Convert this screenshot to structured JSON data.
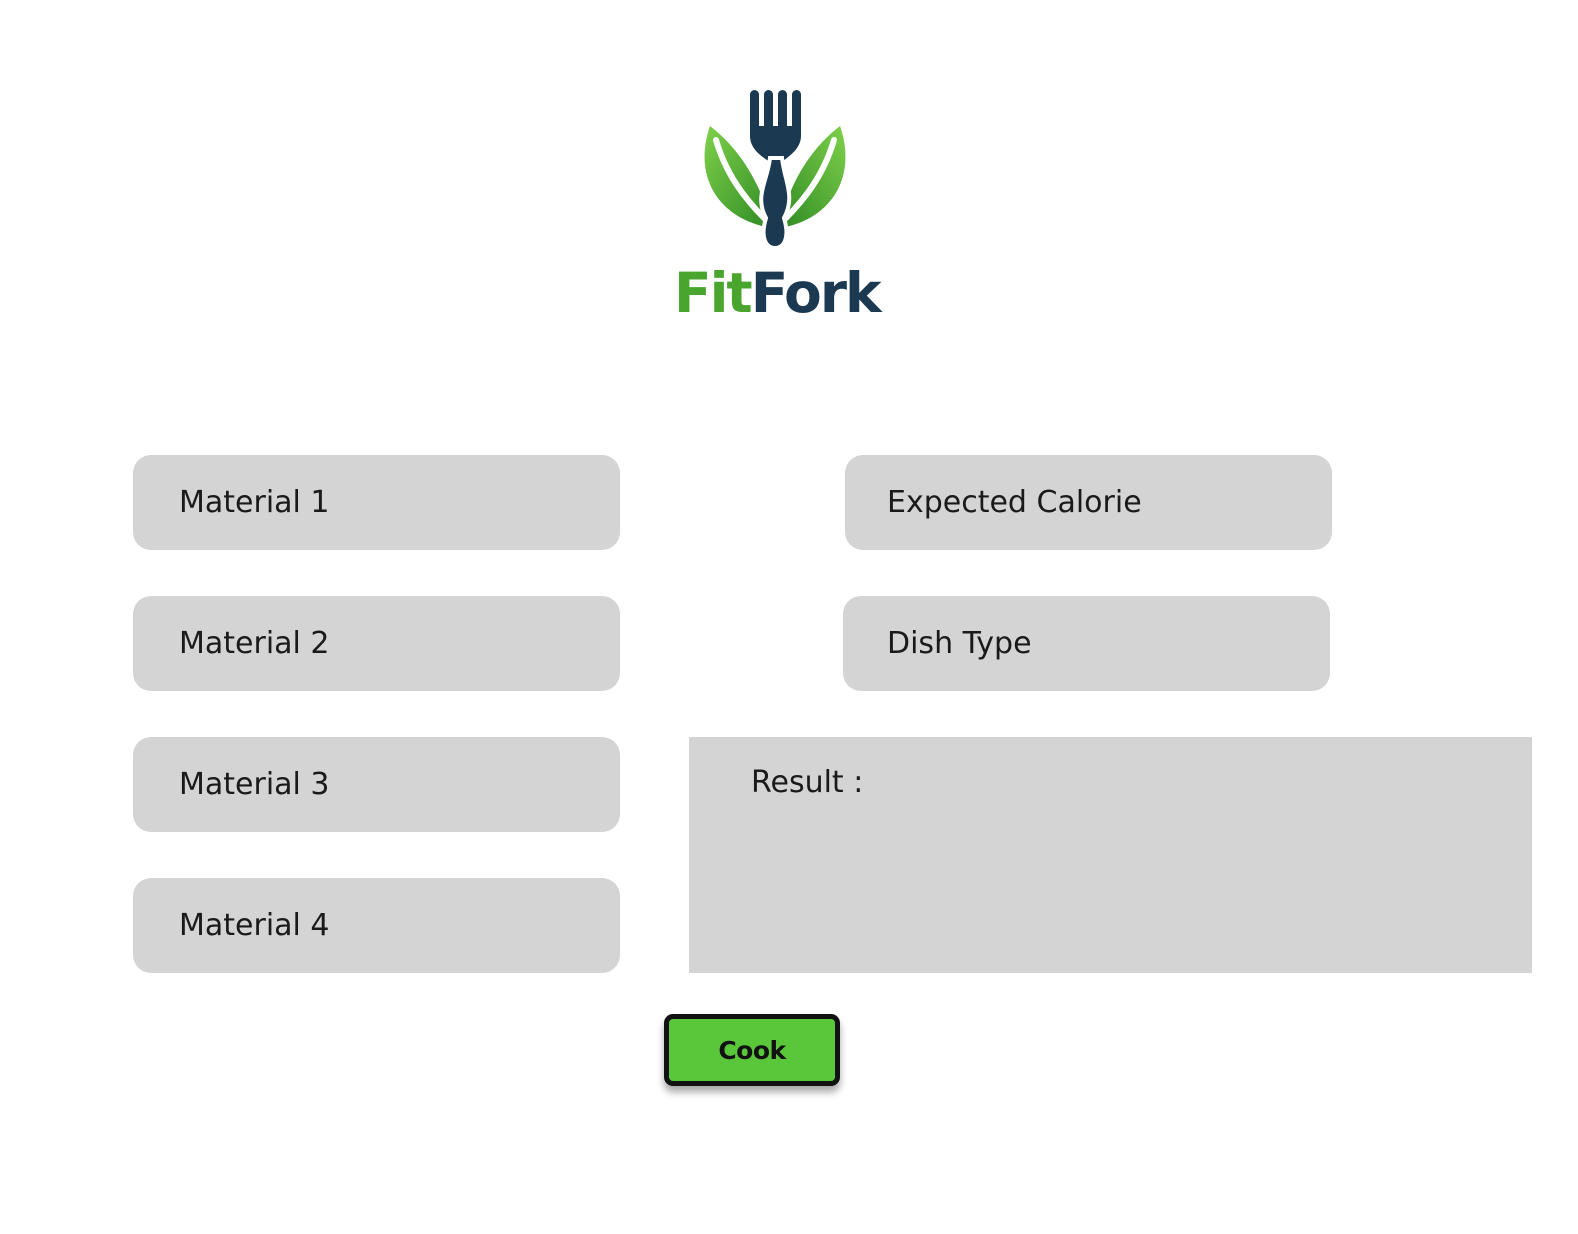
{
  "logo": {
    "word_part_1": "Fit",
    "word_part_2": "Fork",
    "icon": "fork-leaf-icon"
  },
  "inputs": {
    "material_1": {
      "placeholder": "Material 1",
      "value": ""
    },
    "material_2": {
      "placeholder": "Material 2",
      "value": ""
    },
    "material_3": {
      "placeholder": "Material 3",
      "value": ""
    },
    "material_4": {
      "placeholder": "Material 4",
      "value": ""
    },
    "expected_calorie": {
      "placeholder": "Expected Calorie",
      "value": ""
    },
    "dish_type": {
      "placeholder": "Dish Type",
      "value": ""
    }
  },
  "result": {
    "label": "Result :",
    "value": ""
  },
  "cook_button": {
    "label": "Cook"
  },
  "colors": {
    "field_bg": "#d4d4d4",
    "button_bg": "#5ac63a",
    "brand_green": "#4aa52e",
    "brand_navy": "#1b3a52"
  }
}
